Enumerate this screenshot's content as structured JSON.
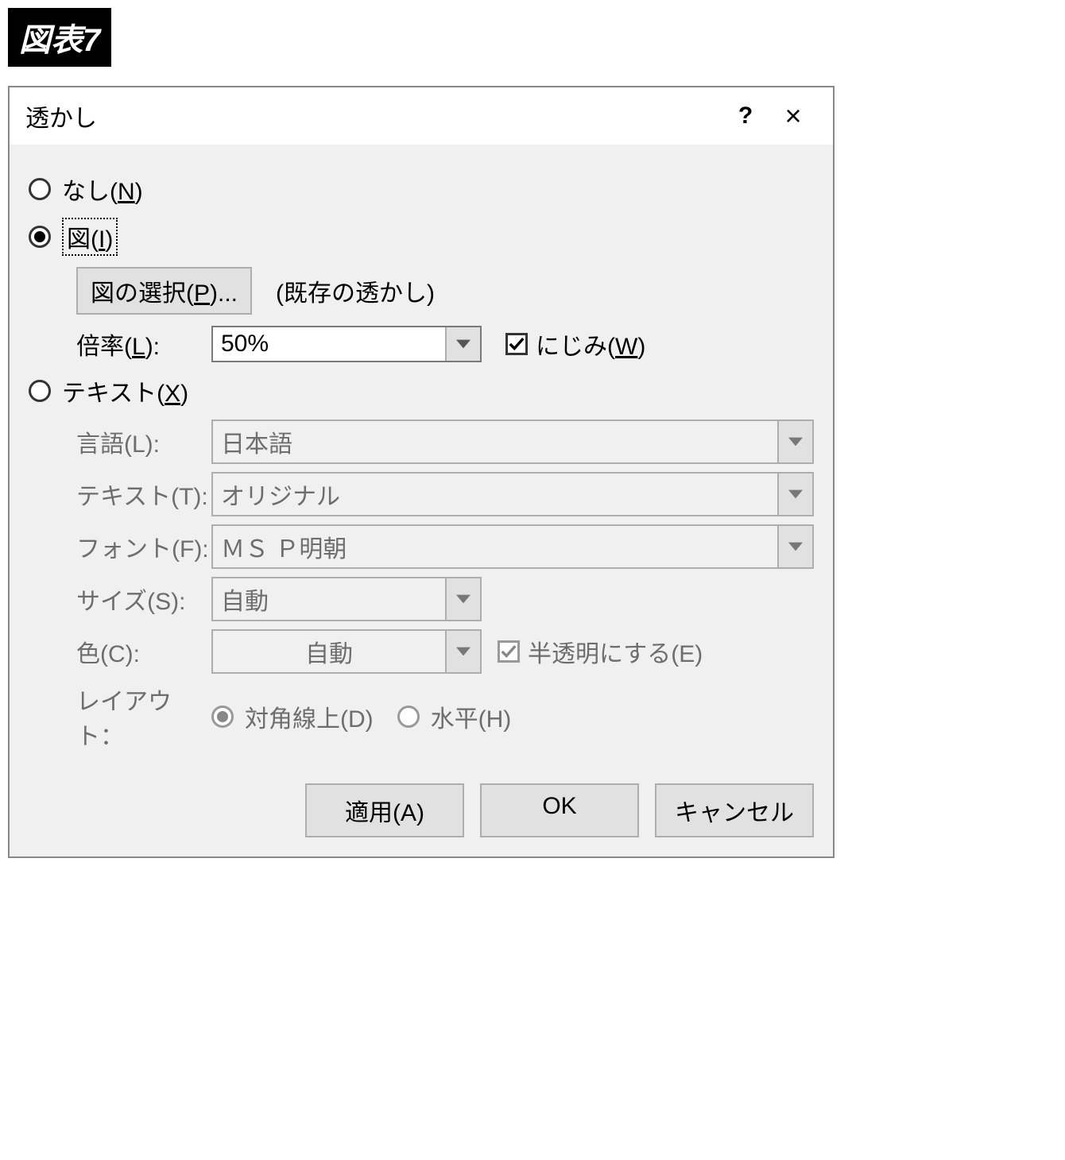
{
  "figure_badge": "図表7",
  "dialog": {
    "title": "透かし",
    "help_label": "?",
    "close_label": "×"
  },
  "options": {
    "none": {
      "prefix": "なし(",
      "key": "N",
      "suffix": ")"
    },
    "picture": {
      "prefix": "図(",
      "key": "I",
      "suffix": ")"
    },
    "text": {
      "prefix": "テキスト(",
      "key": "X",
      "suffix": ")"
    }
  },
  "picture": {
    "select_btn": {
      "prefix": "図の選択(",
      "key": "P",
      "suffix": ")..."
    },
    "existing_label": "(既存の透かし)",
    "scale_label": {
      "prefix": "倍率(",
      "key": "L",
      "suffix": "):"
    },
    "scale_value": "50%",
    "washout": {
      "prefix": "にじみ(",
      "key": "W",
      "suffix": ")"
    }
  },
  "text_section": {
    "language_label": "言語(L):",
    "language_value": "日本語",
    "text_label": "テキスト(T):",
    "text_value": "オリジナル",
    "font_label": "フォント(F):",
    "font_value": "ＭＳ Ｐ明朝",
    "size_label": "サイズ(S):",
    "size_value": "自動",
    "color_label": "色(C):",
    "color_value": "自動",
    "semitransparent_label": "半透明にする(E)",
    "layout_label": "レイアウト：",
    "diagonal_label": "対角線上(D)",
    "horizontal_label": "水平(H)"
  },
  "footer": {
    "apply": "適用(A)",
    "ok": "OK",
    "cancel": "キャンセル"
  }
}
